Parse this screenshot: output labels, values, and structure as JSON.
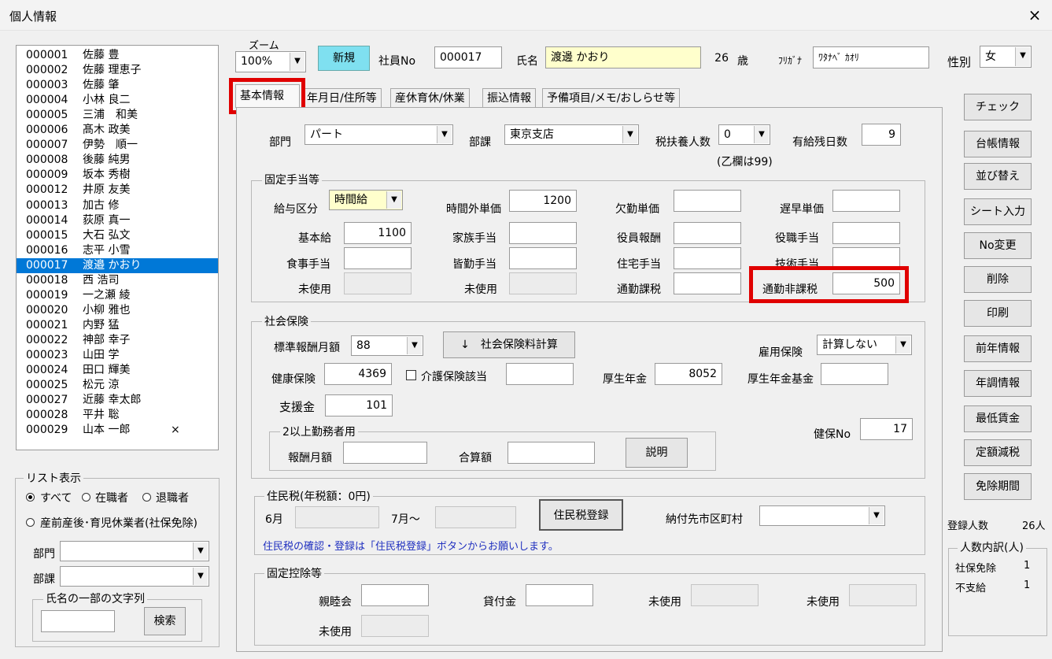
{
  "window": {
    "title": "個人情報",
    "close_glyph": "×"
  },
  "employee_list": [
    {
      "no": "000001",
      "name": "佐藤 豊",
      "mark": ""
    },
    {
      "no": "000002",
      "name": "佐藤 理恵子",
      "mark": ""
    },
    {
      "no": "000003",
      "name": "佐藤 肇",
      "mark": ""
    },
    {
      "no": "000004",
      "name": "小林 良二",
      "mark": ""
    },
    {
      "no": "000005",
      "name": "三浦　和美",
      "mark": ""
    },
    {
      "no": "000006",
      "name": "髙木 政美",
      "mark": ""
    },
    {
      "no": "000007",
      "name": "伊勢　順一",
      "mark": ""
    },
    {
      "no": "000008",
      "name": "後藤 純男",
      "mark": ""
    },
    {
      "no": "000009",
      "name": "坂本 秀樹",
      "mark": ""
    },
    {
      "no": "000012",
      "name": "井原 友美",
      "mark": ""
    },
    {
      "no": "000013",
      "name": "加古 修",
      "mark": ""
    },
    {
      "no": "000014",
      "name": "荻原 真一",
      "mark": ""
    },
    {
      "no": "000015",
      "name": "大石 弘文",
      "mark": ""
    },
    {
      "no": "000016",
      "name": "志平 小雪",
      "mark": ""
    },
    {
      "no": "000017",
      "name": "渡邉 かおり",
      "mark": ""
    },
    {
      "no": "000018",
      "name": "西 浩司",
      "mark": ""
    },
    {
      "no": "000019",
      "name": "一之瀬 綾",
      "mark": ""
    },
    {
      "no": "000020",
      "name": "小柳 雅也",
      "mark": ""
    },
    {
      "no": "000021",
      "name": "内野 猛",
      "mark": ""
    },
    {
      "no": "000022",
      "name": "神部 幸子",
      "mark": ""
    },
    {
      "no": "000023",
      "name": "山田 学",
      "mark": ""
    },
    {
      "no": "000024",
      "name": "田口 輝美",
      "mark": ""
    },
    {
      "no": "000025",
      "name": "松元 涼",
      "mark": ""
    },
    {
      "no": "000027",
      "name": "近藤 幸太郎",
      "mark": ""
    },
    {
      "no": "000028",
      "name": "平井 聡",
      "mark": ""
    },
    {
      "no": "000029",
      "name": "山本 一郎",
      "mark": "×"
    }
  ],
  "selected_index": 14,
  "list_filter": {
    "title": "リスト表示",
    "all": "すべて",
    "active": "在職者",
    "retired": "退職者",
    "leave": "産前産後･育児休業者(社保免除)",
    "dept_label": "部門",
    "section_label": "部課",
    "name_group": "氏名の一部の文字列",
    "search_btn": "検索"
  },
  "header": {
    "zoom_label": "ズーム",
    "zoom_value": "100%",
    "new_btn": "新規",
    "emp_no_label": "社員No",
    "emp_no": "000017",
    "name_label": "氏名",
    "name": "渡邊 かおり",
    "age": "26",
    "age_unit": "歳",
    "furigana_label": "ﾌﾘｶﾞﾅ",
    "furigana": "ﾜﾀﾅﾍﾞ ｶｵﾘ",
    "sex_label": "性別",
    "sex": "女"
  },
  "tabs": [
    "基本情報",
    "年月日/住所等",
    "産休育休/休業",
    "振込情報",
    "予備項目/メモ/おしらせ等"
  ],
  "basic": {
    "dept_label": "部門",
    "dept": "パート",
    "section_label": "部課",
    "section": "東京支店",
    "dependents_label": "税扶養人数",
    "dependents": "0",
    "dependents_note": "(乙欄は99)",
    "paid_leave_label": "有給残日数",
    "paid_leave": "9"
  },
  "allowances": {
    "title": "固定手当等",
    "pay_type_label": "給与区分",
    "pay_type": "時間給",
    "overtime_label": "時間外単価",
    "overtime": "1200",
    "absence_label": "欠勤単価",
    "absence": "",
    "late_label": "遅早単価",
    "late": "",
    "base_label": "基本給",
    "base": "1100",
    "family_label": "家族手当",
    "family": "",
    "officer_label": "役員報酬",
    "officer": "",
    "position_label": "役職手当",
    "position": "",
    "meal_label": "食事手当",
    "meal": "",
    "attendance_label": "皆勤手当",
    "attendance": "",
    "housing_label": "住宅手当",
    "housing": "",
    "tech_label": "技術手当",
    "tech": "",
    "unused1_label": "未使用",
    "unused2_label": "未使用",
    "commute_taxable_label": "通勤課税",
    "commute_taxable": "",
    "commute_nontax_label": "通勤非課税",
    "commute_nontax": "500"
  },
  "social": {
    "title": "社会保険",
    "std_label": "標準報酬月額",
    "std": "88",
    "calc_btn": "↓　社会保険料計算",
    "employment_label": "雇用保険",
    "employment": "計算しない",
    "health_label": "健康保険",
    "health": "4369",
    "care_label": "介護保険該当",
    "care": "",
    "pension_label": "厚生年金",
    "pension": "8052",
    "fund_label": "厚生年金基金",
    "fund": "",
    "support_label": "支援金",
    "support": "101",
    "health_no_label": "健保No",
    "health_no": "17",
    "multi_title": "2以上勤務者用",
    "monthly_label": "報酬月額",
    "monthly": "",
    "total_label": "合算額",
    "total": "",
    "explain_btn": "説明"
  },
  "resident": {
    "title": "住民税(年税額：0円)",
    "june_label": "6月",
    "june": "",
    "july_label": "7月～",
    "july": "",
    "register_btn": "住民税登録",
    "city_label": "納付先市区町村",
    "city": "",
    "note": "住民税の確認・登録は「住民税登録」ボタンからお願いします。"
  },
  "deductions": {
    "title": "固定控除等",
    "club_label": "親睦会",
    "club": "",
    "loan_label": "貸付金",
    "loan": "",
    "unused_label": "未使用"
  },
  "right_buttons": [
    "チェック",
    "台帳情報",
    "並び替え",
    "シート入力",
    "No変更",
    "削除",
    "印刷",
    "前年情報",
    "年調情報",
    "最低賃金",
    "定額減税",
    "免除期間"
  ],
  "summary": {
    "count_label": "登録人数",
    "count": "26人",
    "breakdown_title": "人数内訳(人)",
    "exempt_label": "社保免除",
    "exempt": "1",
    "nonpay_label": "不支給",
    "nonpay": "1"
  },
  "colors": {
    "highlight_red": "#e00000",
    "selection_blue": "#0078d7",
    "name_bg": "#ffffcc",
    "new_btn": "#7fe0f0"
  }
}
